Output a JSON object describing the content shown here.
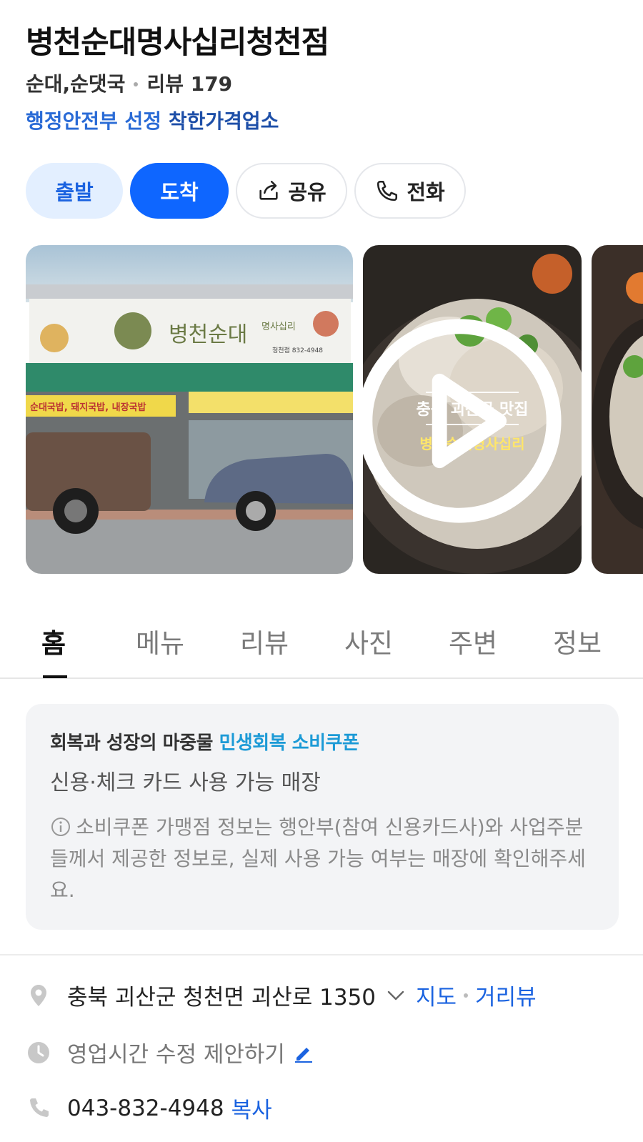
{
  "place": {
    "name": "병천순대명사십리청천점",
    "category": "순대,순댓국",
    "review_label": "리뷰 179",
    "badge_org": "행정안전부 선정",
    "badge_title": "착한가격업소"
  },
  "actions": {
    "start": "출발",
    "arrive": "도착",
    "share": "공유",
    "call": "전화"
  },
  "gallery": {
    "photo2_caption_1": "충북 괴산군 맛집",
    "photo2_caption_2": "병천순대명사십리",
    "sign_name": "병천순대",
    "sign_sub": "명사십리",
    "sign_branch": "청천점 832-4948",
    "banner_left": "순대국밥, 돼지국밥, 내장국밥"
  },
  "tabs": [
    "홈",
    "메뉴",
    "리뷰",
    "사진",
    "주변",
    "정보"
  ],
  "coupon": {
    "title_prefix": "회복과 성장의 마중물",
    "title_highlight": "민생회복 소비쿠폰",
    "subtitle": "신용·체크 카드 사용 가능 매장",
    "note": "소비쿠폰 가맹점 정보는 행안부(참여 신용카드사)와 사업주분들께서 제공한 정보로, 실제 사용 가능 여부는 매장에 확인해주세요."
  },
  "info": {
    "address": "충북 괴산군 청천면 괴산로 1350",
    "map_link": "지도",
    "street_view_link": "거리뷰",
    "hours_suggest": "영업시간 수정 제안하기",
    "phone": "043-832-4948",
    "copy_link": "복사"
  },
  "colors": {
    "primary": "#0e66ff",
    "primary_light": "#e3efff",
    "link": "#1b63e0",
    "coupon_highlight": "#1c9ad6"
  }
}
